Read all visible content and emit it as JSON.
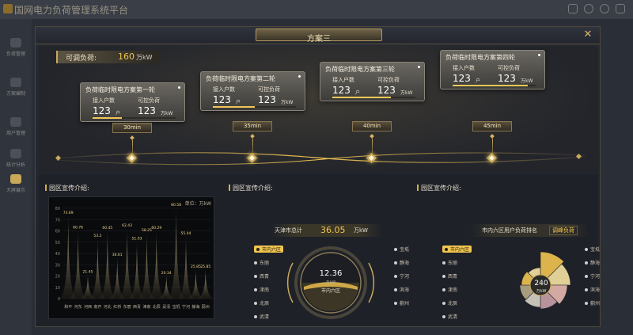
{
  "app": {
    "title": "国网电力负荷管理系统平台",
    "sidebar": [
      {
        "label": "负荷管理"
      },
      {
        "label": "方案编制"
      },
      {
        "label": "用户管理"
      },
      {
        "label": "统计分析"
      },
      {
        "label": "大屏展示"
      }
    ]
  },
  "modal": {
    "title": "方案三",
    "close_icon": "close-icon",
    "available_load": {
      "label": "可调负荷:",
      "value": "160",
      "unit": "万kW"
    },
    "rounds": [
      {
        "title": "负荷临时限电方案第一轮",
        "households_label": "接入户数",
        "households_value": "123",
        "households_unit": "户",
        "load_label": "可控负荷",
        "load_value": "123",
        "load_unit": "万kW",
        "progress": 0.35,
        "duration": "30min"
      },
      {
        "title": "负荷临时限电方案第二轮",
        "households_label": "接入户数",
        "households_value": "123",
        "households_unit": "户",
        "load_label": "可控负荷",
        "load_value": "123",
        "load_unit": "万kW",
        "progress": 0.5,
        "duration": "35min"
      },
      {
        "title": "负荷临时限电方案第三轮",
        "households_label": "接入户数",
        "households_value": "123",
        "households_unit": "户",
        "load_label": "可控负荷",
        "load_value": "123",
        "load_unit": "万kW",
        "progress": 0.7,
        "duration": "40min"
      },
      {
        "title": "负荷临时限电方案第四轮",
        "households_label": "接入户数",
        "households_value": "123",
        "households_unit": "户",
        "load_label": "可控负荷",
        "load_value": "123",
        "load_unit": "万kW",
        "progress": 0.9,
        "duration": "45min"
      }
    ]
  },
  "sections": {
    "left_title": "园区宣传介绍:",
    "mid_title": "园区宣传介绍:",
    "right_title": "园区宣传介绍:"
  },
  "chart_data": {
    "type": "area",
    "unit_label": "单位：万kW",
    "ylim": [
      0,
      80
    ],
    "yticks": [
      0,
      10,
      20,
      30,
      40,
      50,
      60,
      70,
      80
    ],
    "categories": [
      "和平",
      "河东",
      "河西",
      "南开",
      "河北",
      "红桥",
      "东丽",
      "西青",
      "津南",
      "北辰",
      "武清",
      "宝坻",
      "宁河",
      "静海",
      "蓟州"
    ],
    "values": [
      73.69,
      60.76,
      21.45,
      53.2,
      60.45,
      36.61,
      62.43,
      51.03,
      58.25,
      60.29,
      20.34,
      80.58,
      55.44,
      25.85,
      25.85
    ]
  },
  "center": {
    "title": "天津市总计",
    "value": "36.05",
    "unit": "万kW",
    "gauge_value": "12.36",
    "gauge_unit": "万kW",
    "gauge_label": "市内六区",
    "options_left": [
      "市内六区",
      "东丽",
      "西青",
      "津南",
      "北辰",
      "武清"
    ],
    "options_right": [
      "宝坻",
      "静海",
      "宁河",
      "滨海",
      "蓟州"
    ],
    "selected": "市内六区"
  },
  "right": {
    "title": "市内六区用户负荷排名",
    "tag": "调峰负荷",
    "center_value": "240",
    "center_unit": "万kW",
    "options_left": [
      "市内六区",
      "东丽",
      "西青",
      "津南",
      "北辰",
      "武清"
    ],
    "options_right": [
      "宝坻",
      "静海",
      "宁河",
      "滨海",
      "蓟州"
    ],
    "selected": "市内六区",
    "colors": [
      "#f2c550",
      "#f7e3a1",
      "#e7b8b0",
      "#c9a0a8",
      "#d9d3c6",
      "#b7aa88"
    ]
  }
}
